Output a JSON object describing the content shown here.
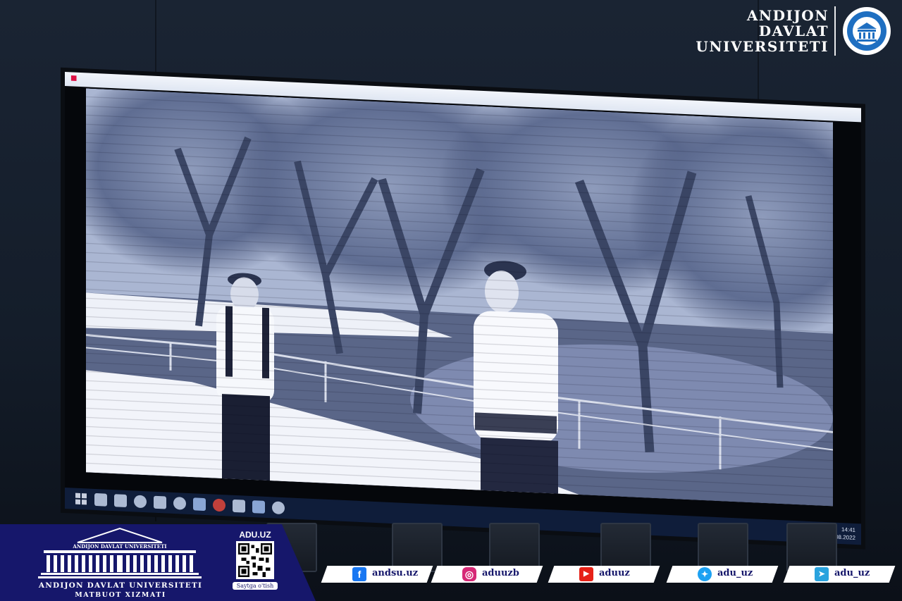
{
  "brand": {
    "line1": "ANDIJON",
    "line2": "DAVLAT",
    "line3": "UNIVERSITETI",
    "logo_icon": "university-building-logo"
  },
  "screen": {
    "taskbar_time": "14:41",
    "taskbar_date": "18.08.2022",
    "scene": "black-and-white video frame: a schoolboy and an elderly man in traditional dress talking on a park path under trees"
  },
  "press": {
    "building_caption": "ANDIJON DAVLAT UNIVERSITETI",
    "title": "ANDIJON DAVLAT UNIVERSITETI",
    "subtitle": "MATBUOT XIZMATI",
    "site": "ADU.UZ",
    "qr_caption": "Saytga o'tish"
  },
  "social": [
    {
      "network": "facebook",
      "handle": "andsu.uz",
      "icon": "facebook-icon",
      "color": "#1877f2"
    },
    {
      "network": "instagram",
      "handle": "aduuzb",
      "icon": "instagram-icon",
      "color": "#d62976"
    },
    {
      "network": "youtube",
      "handle": "aduuz",
      "icon": "youtube-icon",
      "color": "#e62117"
    },
    {
      "network": "twitter",
      "handle": "adu_uz",
      "icon": "twitter-icon",
      "color": "#1da1f2"
    },
    {
      "network": "telegram",
      "handle": "adu_uz",
      "icon": "telegram-icon",
      "color": "#2aa3de"
    }
  ],
  "colors": {
    "press_panel": "#16176b",
    "screen_tint": "#c9d3ea"
  }
}
